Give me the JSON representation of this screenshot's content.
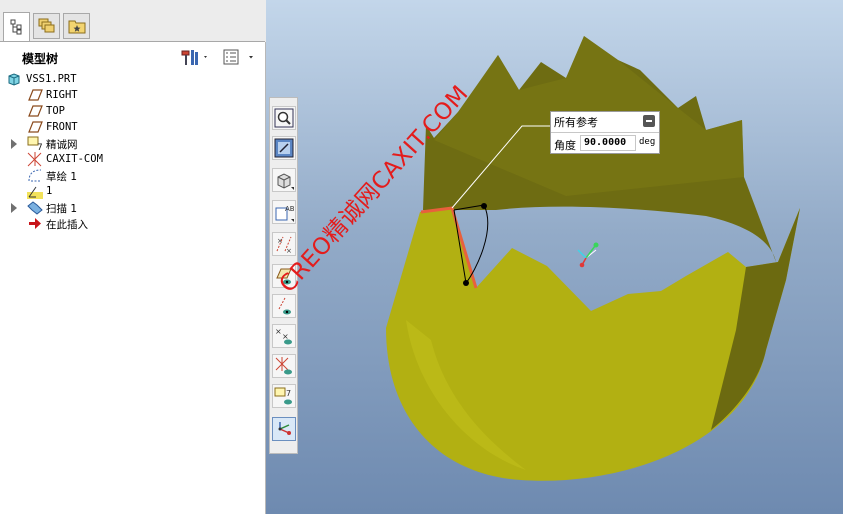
{
  "panel": {
    "tabs": [
      {
        "name": "model-tree-tab",
        "icon": "model-tree-icon",
        "active": true
      },
      {
        "name": "layers-tab",
        "icon": "layers-icon",
        "active": false
      },
      {
        "name": "favorites-tab",
        "icon": "folder-star-icon",
        "active": false
      }
    ],
    "tree_title": "模型树"
  },
  "tree": {
    "items": [
      {
        "label": "VSS1.PRT",
        "icon": "part-icon",
        "expandable": false
      },
      {
        "label": "RIGHT",
        "icon": "datum-plane-icon",
        "expandable": false
      },
      {
        "label": "TOP",
        "icon": "datum-plane-icon",
        "expandable": false
      },
      {
        "label": "FRONT",
        "icon": "datum-plane-icon",
        "expandable": false
      },
      {
        "label": "精诚网",
        "icon": "layer-group-icon",
        "expandable": true
      },
      {
        "label": "CAXIT-COM",
        "icon": "coordinate-system-icon",
        "expandable": false
      },
      {
        "label": "草绘 1",
        "icon": "sketch-icon",
        "expandable": false
      },
      {
        "label": "1",
        "icon": "datum-axis-icon",
        "expandable": false
      },
      {
        "label": "扫描 1",
        "icon": "sweep-icon",
        "expandable": true
      },
      {
        "label": "在此插入",
        "icon": "insert-here-arrow-icon",
        "expandable": false
      }
    ]
  },
  "toolbar": {
    "buttons": [
      {
        "name": "zoom-fit-button",
        "icon": "magnifier-icon"
      },
      {
        "name": "repaint-button",
        "icon": "repaint-icon"
      },
      {
        "name": "display-style-button",
        "icon": "shaded-cube-icon"
      },
      {
        "name": "saved-views-button",
        "icon": "named-view-icon"
      },
      {
        "name": "datum-display-button",
        "icon": "datum-display-icon"
      },
      {
        "name": "plane-display-button",
        "icon": "plane-display-icon"
      },
      {
        "name": "axis-display-button",
        "icon": "axis-display-icon"
      },
      {
        "name": "point-display-button",
        "icon": "point-display-icon"
      },
      {
        "name": "csys-display-button",
        "icon": "csys-display-icon"
      },
      {
        "name": "annotation-display-button",
        "icon": "annotation-display-icon"
      },
      {
        "name": "spin-center-button",
        "icon": "spin-center-icon",
        "selected": true
      }
    ]
  },
  "callout": {
    "title": "所有参考",
    "angle_label": "角度",
    "angle_value": "90.0000",
    "angle_unit": "deg"
  },
  "watermark": "CREO精诚网CAXIT.COM",
  "colors": {
    "viewport_top": "#c3d6ea",
    "viewport_bottom": "#6e8ab0",
    "surface_front": "#b2b012",
    "surface_back": "#6e6c12",
    "trajectory": "#e8603c",
    "watermark": "#e41c1c"
  }
}
